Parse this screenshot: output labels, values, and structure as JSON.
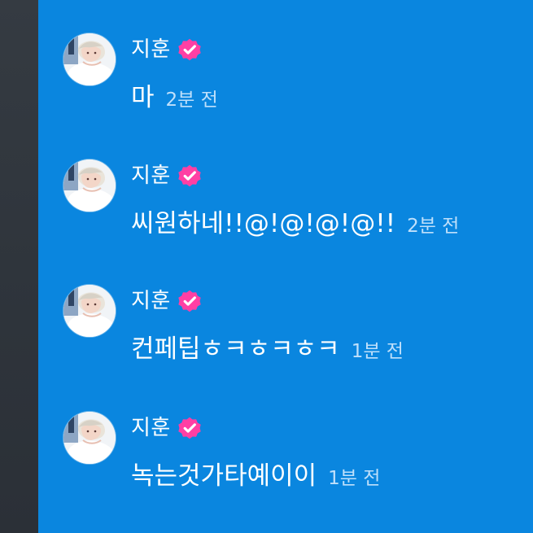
{
  "colors": {
    "background": "#0a86df",
    "left_gutter": "#30363d",
    "text": "#ffffff",
    "timestamp": "#bfe0fb",
    "verified_badge": "#ff3fa4"
  },
  "messages": [
    {
      "author": "지훈",
      "verified_icon": "pink-verified-badge-icon",
      "avatar_icon": "user-avatar-photo",
      "text": "마",
      "time": "2분 전"
    },
    {
      "author": "지훈",
      "verified_icon": "pink-verified-badge-icon",
      "avatar_icon": "user-avatar-photo",
      "text": "씨원하네!!@!@!@!@!!",
      "time": "2분 전"
    },
    {
      "author": "지훈",
      "verified_icon": "pink-verified-badge-icon",
      "avatar_icon": "user-avatar-photo",
      "text": "컨페팁ㅎㅋㅎㅋㅎㅋ",
      "time": "1분 전"
    },
    {
      "author": "지훈",
      "verified_icon": "pink-verified-badge-icon",
      "avatar_icon": "user-avatar-photo",
      "text": "녹는것가타예이이",
      "time": "1분 전"
    }
  ]
}
